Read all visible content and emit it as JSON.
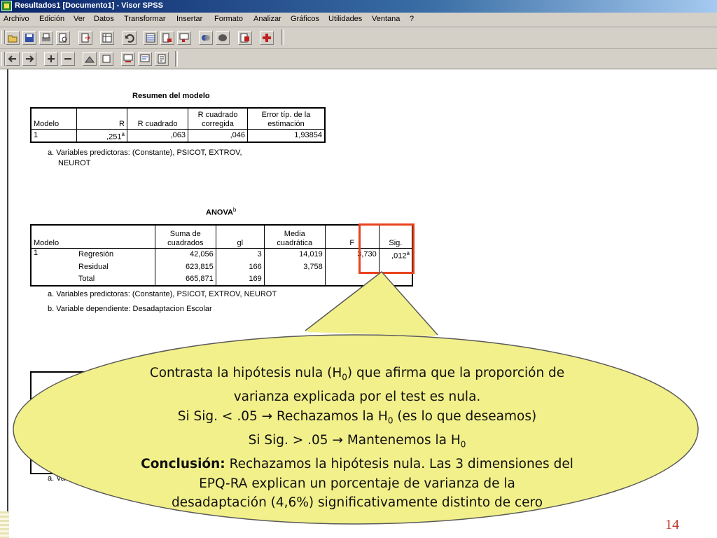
{
  "window": {
    "title": "Resultados1 [Documento1] - Visor SPSS"
  },
  "menu": [
    "Archivo",
    "Edición",
    "Ver",
    "Datos",
    "Transformar",
    "Insertar",
    "Formato",
    "Analizar",
    "Gráficos",
    "Utilidades",
    "Ventana",
    "?"
  ],
  "toolbar1_icons": [
    "open-icon",
    "save-icon",
    "print-icon",
    "print-preview-icon",
    "export-icon",
    "goto-data-icon",
    "undo-icon",
    "goto-chart-icon",
    "insert-cases-icon",
    "insert-variable-icon",
    "select-cases-icon",
    "stop-icon",
    "split-icon",
    "weight-icon",
    "value-labels-icon"
  ],
  "toolbar2_icons": [
    "promote-icon",
    "demote-icon",
    "expand-icon",
    "collapse-icon",
    "show-icon",
    "hide-icon",
    "insert-heading-icon",
    "insert-title-icon",
    "insert-text-icon"
  ],
  "model_summary": {
    "title": "Resumen del modelo",
    "headers": [
      "Modelo",
      "R",
      "R cuadrado",
      "R cuadrado corregida",
      "Error típ. de la estimación"
    ],
    "headers_line1": [
      "",
      "",
      "",
      "R cuadrado",
      "Error típ. de la"
    ],
    "headers_line2": [
      "Modelo",
      "R",
      "R cuadrado",
      "corregida",
      "estimación"
    ],
    "row": [
      "1",
      ",251",
      "a",
      ",063",
      ",046",
      "1,93854"
    ],
    "footnote_line1": "a. Variables predictoras: (Constante), PSICOT, EXTROV,",
    "footnote_line2": "NEUROT"
  },
  "anova": {
    "title": "ANOVA",
    "title_sup": "b",
    "headers_line1": [
      "",
      "Suma de",
      "",
      "Media",
      "",
      ""
    ],
    "headers_line2": [
      "Modelo",
      "cuadrados",
      "gl",
      "cuadrática",
      "F",
      "Sig."
    ],
    "model": "1",
    "rows": [
      {
        "label": "Regresión",
        "ss": "42,056",
        "gl": "3",
        "ms": "14,019",
        "f": "3,730",
        "sig": ",012",
        "sig_sup": "a"
      },
      {
        "label": "Residual",
        "ss": "623,815",
        "gl": "166",
        "ms": "3,758",
        "f": "",
        "sig": "",
        "sig_sup": ""
      },
      {
        "label": "Total",
        "ss": "665,871",
        "gl": "169",
        "ms": "",
        "f": "",
        "sig": "",
        "sig_sup": ""
      }
    ],
    "footnote_a": "a. Variables predictoras: (Constante), PSICOT, EXTROV, NEUROT",
    "footnote_b": "b. Variable dependiente: Desadaptacion Escolar"
  },
  "coefficients_fragment": {
    "footnote_partial": "a. Va"
  },
  "callout": {
    "line1_pre": "Contrasta la hipótesis nula (H",
    "line1_sub": "0",
    "line1_post": ") que afirma que la proporción de",
    "line2": "varianza explicada por el test es nula.",
    "line3_pre": "Si Sig. < .05  → Rechazamos la H",
    "line3_sub": "0",
    "line3_post": " (es lo que deseamos)",
    "line4_pre": "Si Sig. > .05  → Mantenemos la H",
    "line4_sub": "0",
    "line5_bold": "Conclusión:",
    "line5_rest": " Rechazamos la hipótesis nula. Las 3 dimensiones del",
    "line6": "EPQ-RA explican un porcentaje de varianza de la",
    "line7": "desadaptación (4,6%) significativamente distinto de cero",
    "fill_color": "#f2f08a",
    "highlight_color": "#e8411c"
  },
  "slide": {
    "page_number": "14"
  }
}
